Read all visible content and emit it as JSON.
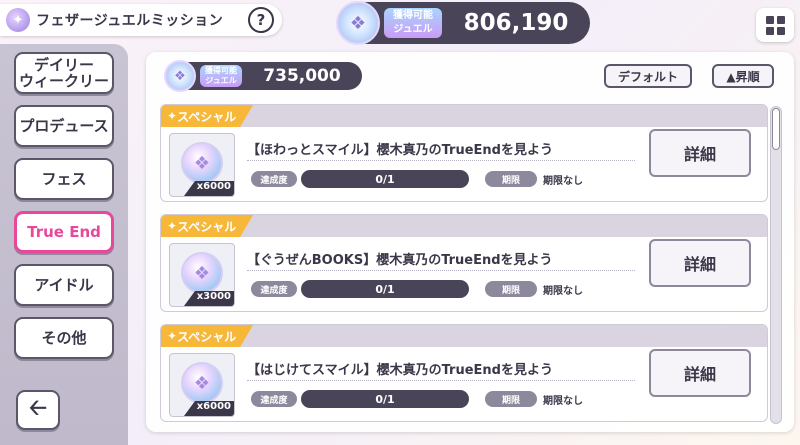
{
  "header": {
    "title": "フェザージュエルミッション",
    "help_label": "?",
    "jewel_label": "獲得可能\nジュエル",
    "jewel_value": "806,190",
    "icons": {
      "title": "feather-jewel-icon",
      "grid": "grid-menu-icon"
    }
  },
  "sidebar": {
    "items": [
      {
        "label": "デイリー\nウィークリー",
        "active": false
      },
      {
        "label": "プロデュース",
        "active": false
      },
      {
        "label": "フェス",
        "active": false
      },
      {
        "label": "True End",
        "active": true
      },
      {
        "label": "アイドル",
        "active": false
      },
      {
        "label": "その他",
        "active": false
      }
    ],
    "back_icon": "arrow-left-icon"
  },
  "panel": {
    "jewel_label": "獲得可能\nジュエル",
    "jewel_value": "735,000",
    "default_button": "デフォルト",
    "sort_button": "▲昇順"
  },
  "missions": [
    {
      "tag": "スペシャル",
      "title": "【ほわっとスマイル】櫻木真乃のTrueEndを見よう",
      "reward_count": "x6000",
      "progress_label": "達成度",
      "progress_text": "0/1",
      "progress_value": 0,
      "deadline_label": "期限",
      "deadline_value": "期限なし",
      "detail_button": "詳細"
    },
    {
      "tag": "スペシャル",
      "title": "【ぐうぜんBOOKS】櫻木真乃のTrueEndを見よう",
      "reward_count": "x3000",
      "progress_label": "達成度",
      "progress_text": "0/1",
      "progress_value": 0,
      "deadline_label": "期限",
      "deadline_value": "期限なし",
      "detail_button": "詳細"
    },
    {
      "tag": "スペシャル",
      "title": "【はじけてスマイル】櫻木真乃のTrueEndを見よう",
      "reward_count": "x6000",
      "progress_label": "達成度",
      "progress_text": "0/1",
      "progress_value": 0,
      "deadline_label": "期限",
      "deadline_value": "期限なし",
      "detail_button": "詳細"
    }
  ],
  "colors": {
    "accent": "#e8479a",
    "special_tag": "#f7b83a",
    "dark": "#4a4458"
  }
}
